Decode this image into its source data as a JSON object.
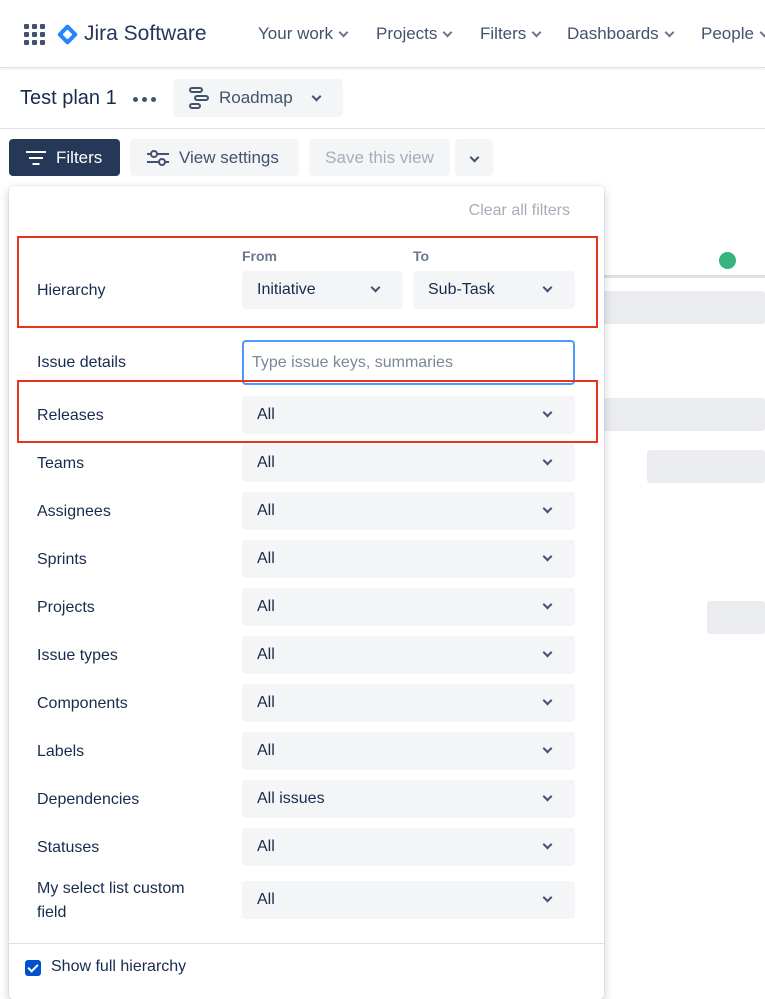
{
  "nav": {
    "app_name": "Jira Software",
    "items": [
      {
        "label": "Your work"
      },
      {
        "label": "Projects"
      },
      {
        "label": "Filters"
      },
      {
        "label": "Dashboards"
      },
      {
        "label": "People"
      }
    ]
  },
  "titlebar": {
    "plan_name": "Test plan 1",
    "view_selector": "Roadmap"
  },
  "toolbar": {
    "filters_label": "Filters",
    "view_settings_label": "View settings",
    "save_view_label": "Save this view"
  },
  "panel": {
    "clear_all": "Clear all filters",
    "hierarchy": {
      "label": "Hierarchy",
      "from_label": "From",
      "to_label": "To",
      "from_value": "Initiative",
      "to_value": "Sub-Task"
    },
    "issue_details": {
      "label": "Issue details",
      "placeholder": "Type issue keys, summaries"
    },
    "rows": [
      {
        "label": "Releases",
        "value": "All"
      },
      {
        "label": "Teams",
        "value": "All"
      },
      {
        "label": "Assignees",
        "value": "All"
      },
      {
        "label": "Sprints",
        "value": "All"
      },
      {
        "label": "Projects",
        "value": "All"
      },
      {
        "label": "Issue types",
        "value": "All"
      },
      {
        "label": "Components",
        "value": "All"
      },
      {
        "label": "Labels",
        "value": "All"
      },
      {
        "label": "Dependencies",
        "value": "All issues"
      },
      {
        "label": "Statuses",
        "value": "All"
      },
      {
        "label": "My select list custom field",
        "value": "All"
      }
    ],
    "show_full_hierarchy": {
      "label": "Show full hierarchy",
      "checked": true
    }
  },
  "colors": {
    "accent": "#0052cc",
    "filters_button": "#253858",
    "highlight": "#e8341c",
    "status_dot": "#36b37e"
  }
}
